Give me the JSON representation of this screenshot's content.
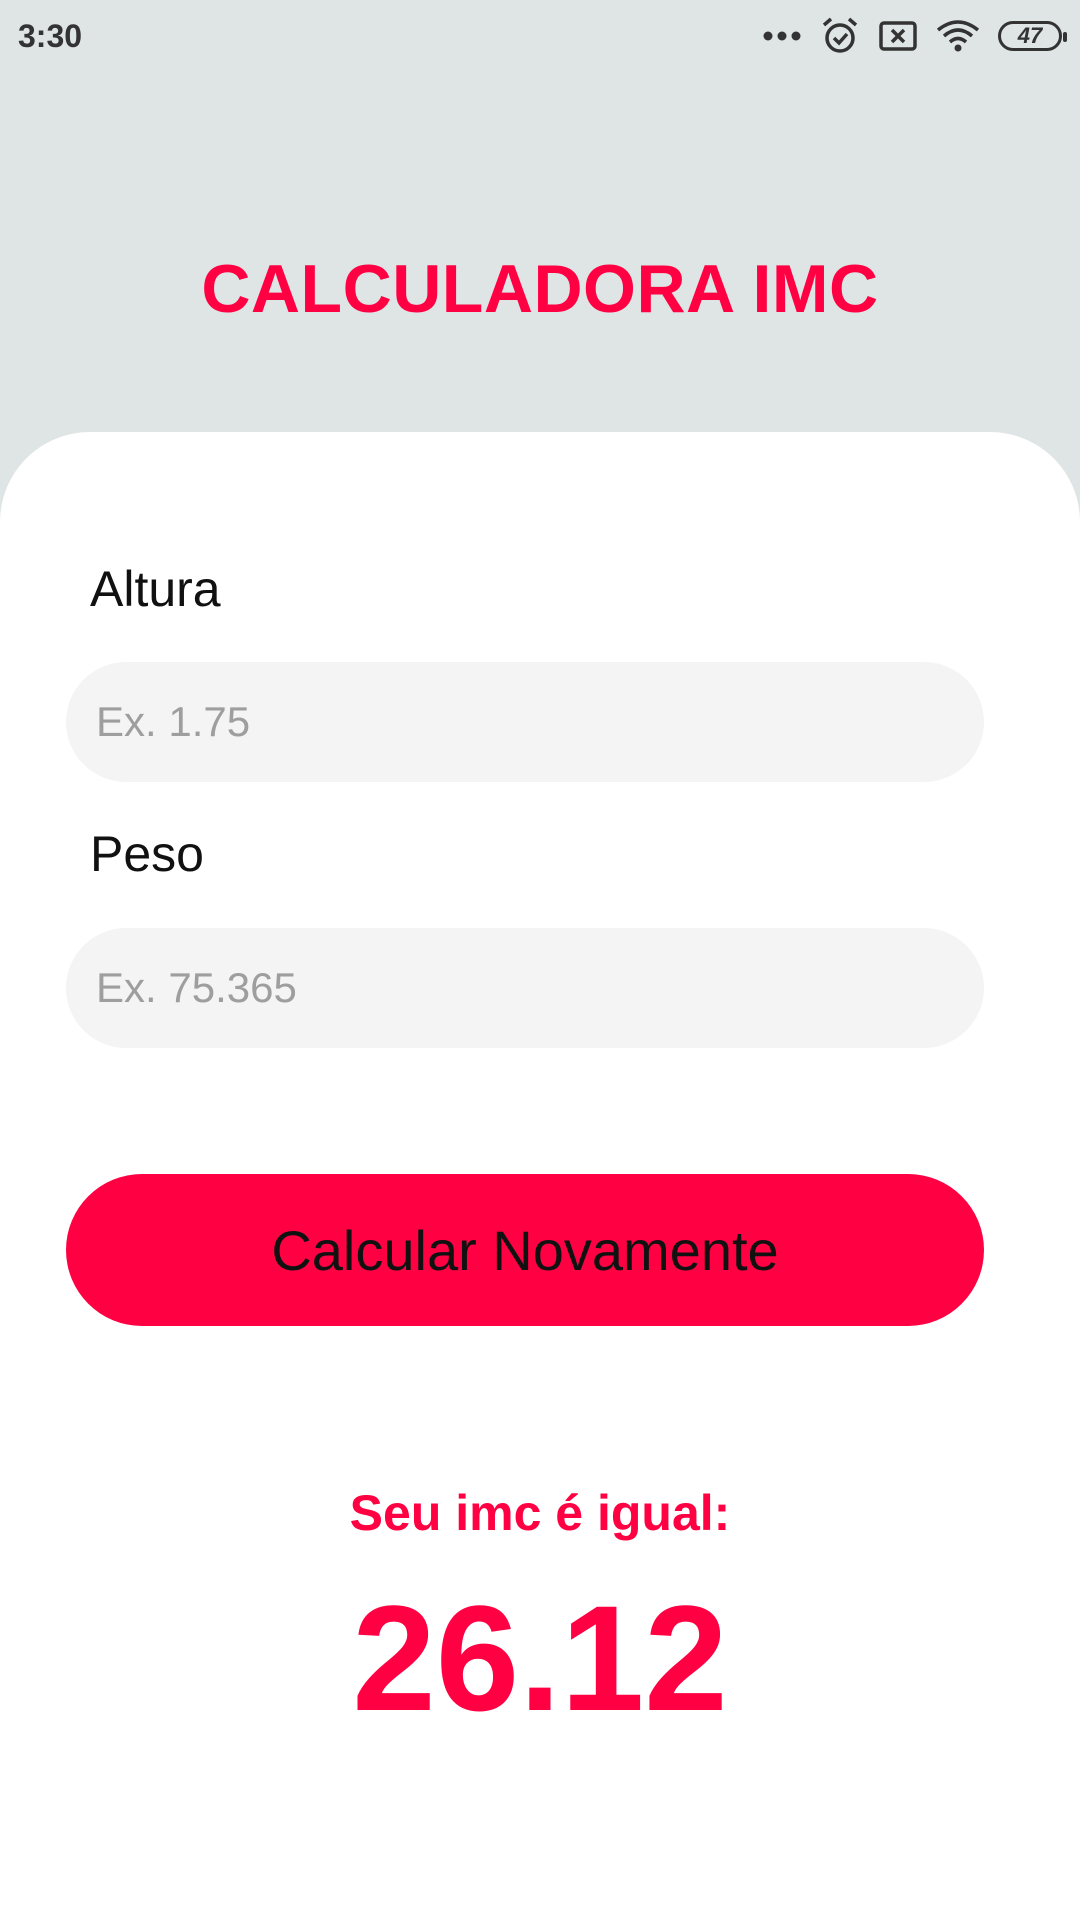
{
  "status_bar": {
    "time": "3:30",
    "battery": "47",
    "icons": [
      "more-dots-icon",
      "alarm-icon",
      "sim-off-icon",
      "wifi-icon",
      "battery-icon"
    ]
  },
  "header": {
    "title": "CALCULADORA IMC"
  },
  "form": {
    "height_label": "Altura",
    "height_placeholder": "Ex. 1.75",
    "height_value": "",
    "weight_label": "Peso",
    "weight_placeholder": "Ex. 75.365",
    "weight_value": "",
    "button_label": "Calcular Novamente"
  },
  "result": {
    "label": "Seu imc é igual:",
    "value": "26.12"
  },
  "colors": {
    "accent": "#ff0043",
    "background": "#dfe4e4",
    "card": "#ffffff",
    "input_bg": "#f4f4f4"
  }
}
